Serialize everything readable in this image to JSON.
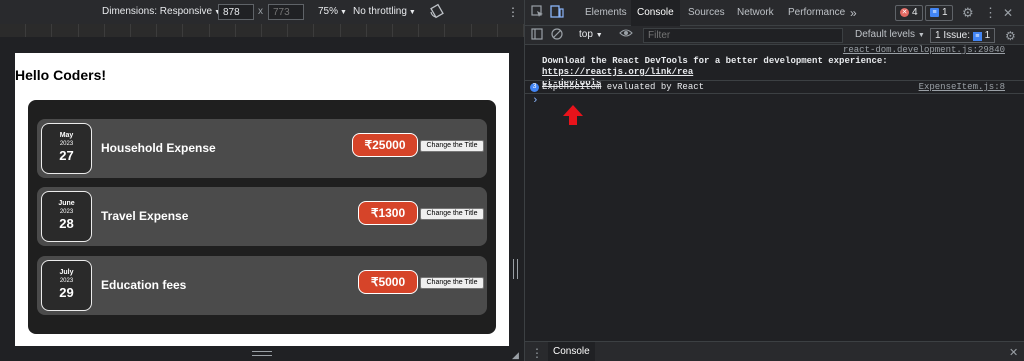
{
  "device_toolbar": {
    "dimensions_label": "Dimensions: Responsive",
    "width": "878",
    "height_placeholder": "773",
    "times": "x",
    "zoom": "75%",
    "throttling": "No throttling"
  },
  "app": {
    "heading": "Hello Coders!",
    "change_title_label": "Change the Title",
    "expenses": [
      {
        "month": "May",
        "year": "2023",
        "day": "27",
        "title": "Household Expense",
        "amount": "₹25000"
      },
      {
        "month": "June",
        "year": "2023",
        "day": "28",
        "title": "Travel Expense",
        "amount": "₹1300"
      },
      {
        "month": "July",
        "year": "2023",
        "day": "29",
        "title": "Education fees",
        "amount": "₹5000"
      }
    ]
  },
  "devtools": {
    "tabs": [
      "Elements",
      "Console",
      "Sources",
      "Network",
      "Performance"
    ],
    "more_tabs": "»",
    "errors_count": "4",
    "messages_count": "1",
    "context": "top",
    "filter_placeholder": "Filter",
    "default_levels": "Default levels",
    "issues_label": "1 Issue:",
    "issues_count": "1",
    "console_lines": {
      "source1": "react-dom.development.js:29840",
      "download_text": "Download the React DevTools for a better development experience: ",
      "link_part1": "https://reactjs.org/link/rea",
      "link_part2": "ct-devtools",
      "count_badge": "3",
      "log_text": "ExpenseItem evaluated by React",
      "source2": "ExpenseItem.js:8",
      "prompt": "›"
    },
    "drawer_tab": "Console"
  },
  "colors": {
    "price_bg": "#d64429",
    "card_bg": "#4b4b4b",
    "container_bg": "#1f1f1f",
    "arrow": "#e8131b",
    "error_dot": "#e46962",
    "info_dot": "#4285f4"
  }
}
